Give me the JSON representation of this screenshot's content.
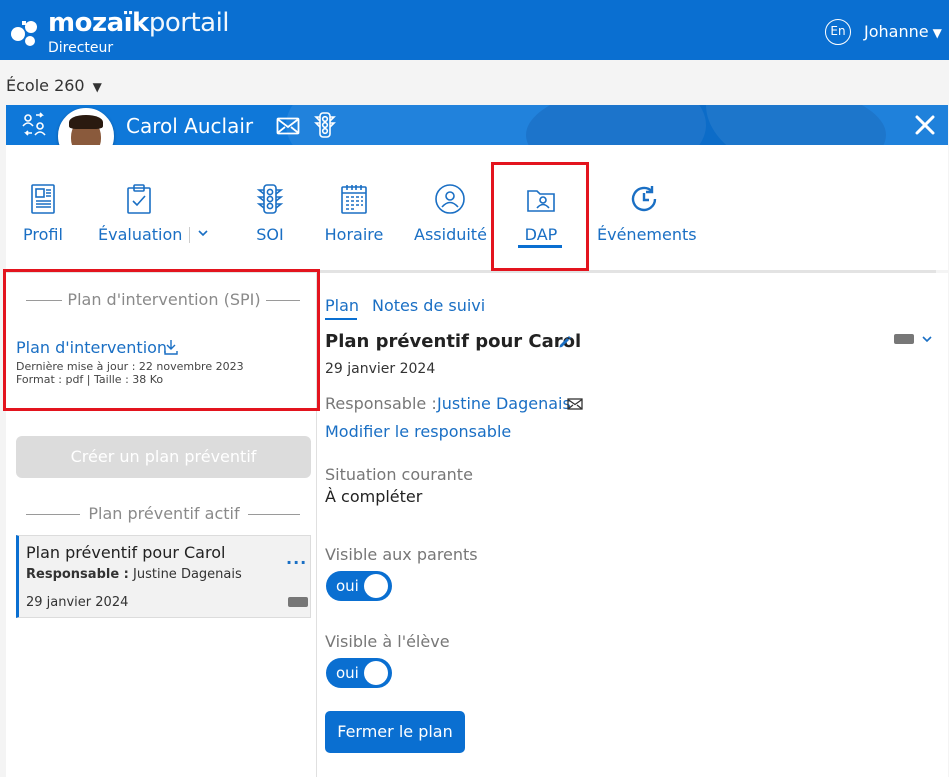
{
  "header": {
    "brand_bold": "mozaïk",
    "brand_light": "portail",
    "role": "Directeur",
    "language": "En",
    "user": "Johanne"
  },
  "school": {
    "name": "École 260"
  },
  "student": {
    "name": "Carol Auclair"
  },
  "nav": {
    "items": [
      {
        "label": "Profil",
        "icon": "profile-icon"
      },
      {
        "label": "Évaluation",
        "icon": "clipboard-check-icon"
      },
      {
        "label": "SOI",
        "icon": "traffic-light-icon"
      },
      {
        "label": "Horaire",
        "icon": "calendar-icon"
      },
      {
        "label": "Assiduité",
        "icon": "person-circle-icon"
      },
      {
        "label": "DAP",
        "icon": "folder-person-icon"
      },
      {
        "label": "Événements",
        "icon": "history-icon"
      }
    ],
    "active": "DAP"
  },
  "left": {
    "spi_section_title": "Plan d'intervention (SPI)",
    "spi_link": "Plan d'intervention",
    "spi_updated": "Dernière mise à jour : 22 novembre 2023",
    "spi_format": "Format : pdf | Taille : 38 Ko",
    "create_button": "Créer un plan préventif",
    "active_section_title": "Plan préventif actif",
    "card": {
      "title": "Plan préventif pour Carol",
      "resp_label": "Responsable :",
      "resp_name": "Justine Dagenais",
      "date": "29 janvier 2024",
      "menu": "..."
    }
  },
  "right": {
    "tabs": [
      {
        "label": "Plan"
      },
      {
        "label": "Notes de suivi"
      }
    ],
    "plan_title": "Plan préventif pour Carol",
    "plan_date": "29 janvier 2024",
    "resp_label": "Responsable :",
    "resp_name": "Justine Dagenais",
    "modify_link": "Modifier le responsable",
    "situation_label": "Situation courante",
    "situation_value": "À compléter",
    "visible_parents_label": "Visible aux parents",
    "visible_parents_value": "oui",
    "visible_student_label": "Visible à l'élève",
    "visible_student_value": "oui",
    "close_button": "Fermer le plan"
  },
  "colors": {
    "brand_blue": "#0a6fd1",
    "link_blue": "#1a6fc4",
    "highlight_red": "#e3141e"
  }
}
